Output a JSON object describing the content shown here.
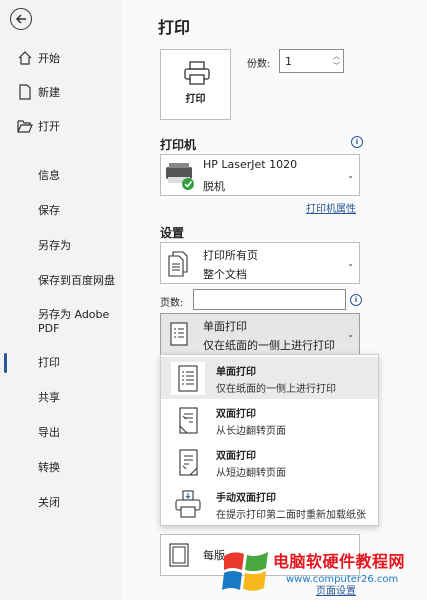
{
  "sidebar": {
    "items": [
      {
        "label": "开始",
        "icon": "home-icon"
      },
      {
        "label": "新建",
        "icon": "new-doc-icon"
      },
      {
        "label": "打开",
        "icon": "folder-open-icon"
      },
      {
        "label": "信息"
      },
      {
        "label": "保存"
      },
      {
        "label": "另存为"
      },
      {
        "label": "保存到百度网盘"
      },
      {
        "label": "另存为 Adobe PDF"
      },
      {
        "label": "打印",
        "active": true
      },
      {
        "label": "共享"
      },
      {
        "label": "导出"
      },
      {
        "label": "转换"
      },
      {
        "label": "关闭"
      }
    ]
  },
  "main": {
    "title": "打印",
    "print_button": "打印",
    "copies_label": "份数:",
    "copies_value": "1",
    "printer_section": "打印机",
    "printer_name": "HP LaserJet 1020",
    "printer_status": "脱机",
    "printer_properties": "打印机属性",
    "settings_section": "设置",
    "range_l1": "打印所有页",
    "range_l2": "整个文档",
    "pages_label": "页数:",
    "pages_value": "",
    "duplex_l1": "单面打印",
    "duplex_l2": "仅在纸面的一侧上进行打印",
    "per_sheet_partial": "每版",
    "page_setup_link": "页面设置"
  },
  "popup": {
    "options": [
      {
        "t1": "单面打印",
        "t2": "仅在纸面的一侧上进行打印"
      },
      {
        "t1": "双面打印",
        "t2": "从长边翻转页面"
      },
      {
        "t1": "双面打印",
        "t2": "从短边翻转页面"
      },
      {
        "t1": "手动双面打印",
        "t2": "在提示打印第二面时重新加载纸张"
      }
    ]
  },
  "watermark": {
    "text": "电脑软硬件教程网",
    "url": "www.computer26.com"
  },
  "colors": {
    "accent": "#2b579a",
    "watermark": "#e4161f"
  }
}
